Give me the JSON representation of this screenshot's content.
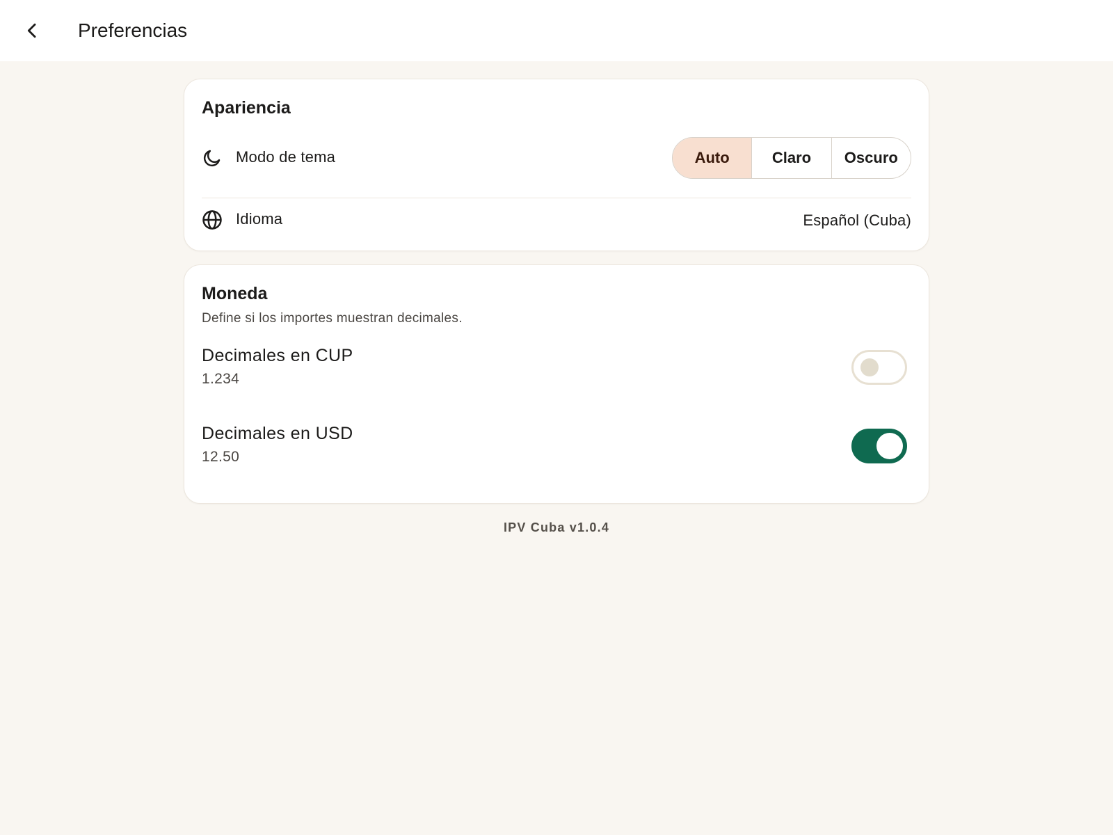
{
  "header": {
    "title": "Preferencias",
    "back_icon": "chevron-left-icon"
  },
  "appearance": {
    "title": "Apariencia",
    "theme": {
      "icon": "moon-icon",
      "label": "Modo de tema",
      "options": [
        "Auto",
        "Claro",
        "Oscuro"
      ],
      "selected": "Auto",
      "selected_color": "#f8dfd0"
    },
    "language": {
      "icon": "globe-icon",
      "label": "Idioma",
      "value": "Español (Cuba)"
    }
  },
  "currency": {
    "title": "Moneda",
    "subtitle": "Define si los importes muestran decimales.",
    "cup": {
      "label": "Decimales en CUP",
      "sample": "1.234",
      "enabled": false
    },
    "usd": {
      "label": "Decimales en USD",
      "sample": "12.50",
      "enabled": true,
      "accent_color": "#0f6a50"
    }
  },
  "footer": {
    "version": "IPV Cuba v1.0.4"
  }
}
